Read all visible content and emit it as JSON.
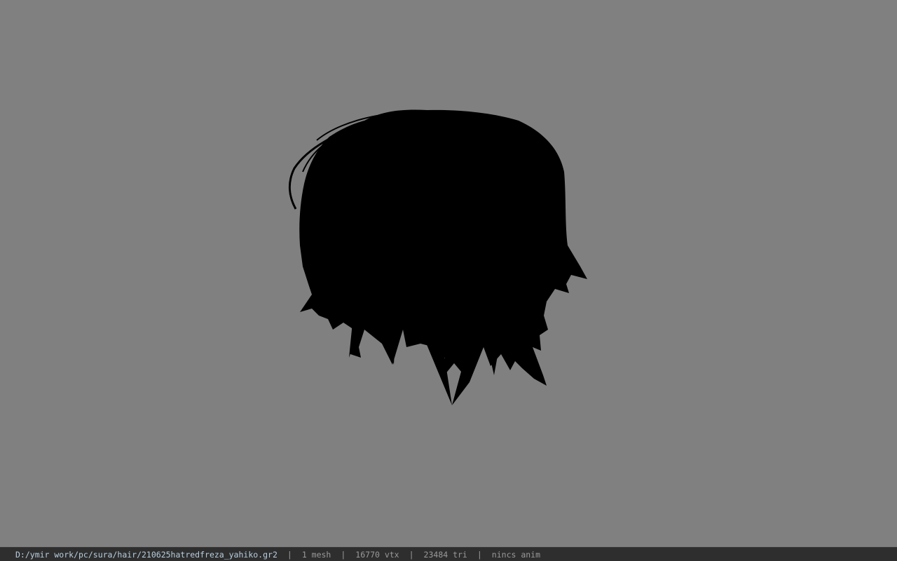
{
  "viewport": {
    "background_color": "#808080",
    "model_color": "#000000",
    "model": "hair-mesh"
  },
  "status_bar": {
    "file_path": "D:/ymir work/pc/sura/hair/210625hatredfreza_yahiko.gr2",
    "separator": "|",
    "mesh_count": "1 mesh",
    "vertex_count": "16770 vtx",
    "triangle_count": "23484 tri",
    "animation": "nincs anim"
  }
}
